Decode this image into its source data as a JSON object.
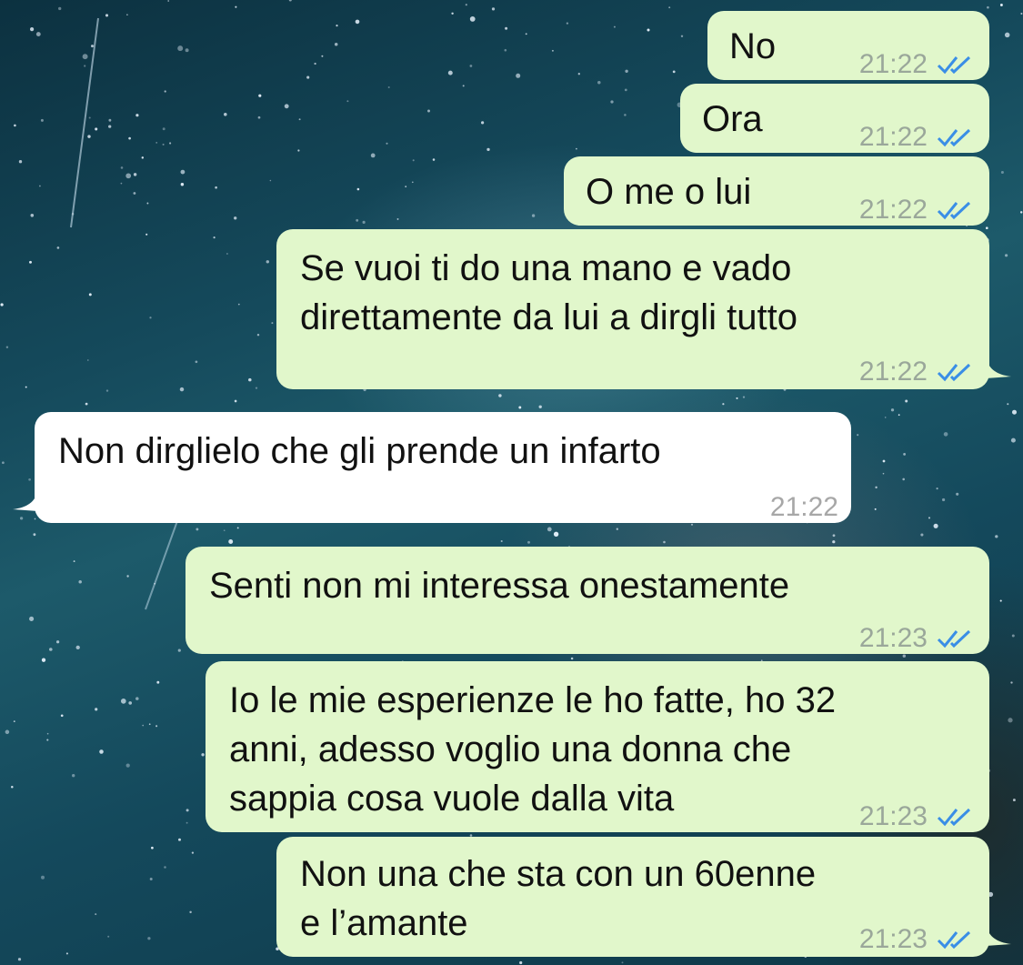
{
  "chat": {
    "messages": [
      {
        "direction": "outgoing",
        "text": "No",
        "time": "21:22",
        "status": "read-double-check-icon"
      },
      {
        "direction": "outgoing",
        "text": "Ora",
        "time": "21:22",
        "status": "read-double-check-icon"
      },
      {
        "direction": "outgoing",
        "text": "O me o lui",
        "time": "21:22",
        "status": "read-double-check-icon"
      },
      {
        "direction": "outgoing",
        "text": "Se vuoi ti do una mano e vado\ndirettamente da lui a dirgli tutto",
        "time": "21:22",
        "status": "read-double-check-icon"
      },
      {
        "direction": "incoming",
        "text": "Non dirglielo che gli prende un infarto",
        "time": "21:22"
      },
      {
        "direction": "outgoing",
        "text": "Senti non mi interessa onestamente",
        "time": "21:23",
        "status": "read-double-check-icon"
      },
      {
        "direction": "outgoing",
        "text": "Io le mie esperienze le ho fatte, ho 32\nanni, adesso voglio una donna che\nsappia cosa vuole dalla vita",
        "time": "21:23",
        "status": "read-double-check-icon"
      },
      {
        "direction": "outgoing",
        "text": "Non una che sta con un 60enne\ne l’amante",
        "time": "21:23",
        "status": "read-double-check-icon"
      }
    ]
  },
  "colors": {
    "outgoing_bubble": "#e1f7cb",
    "incoming_bubble": "#ffffff",
    "read_ticks": "#3a8ee6",
    "timestamp": "#9aa79a"
  }
}
